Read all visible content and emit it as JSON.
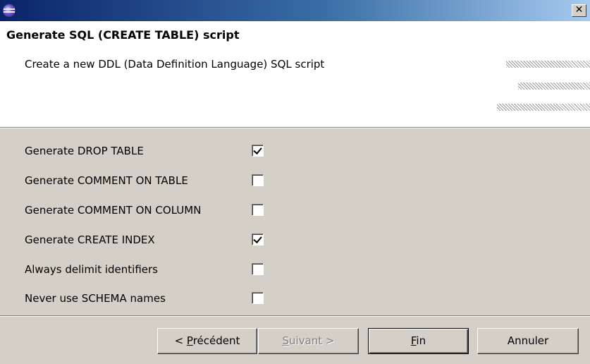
{
  "window": {
    "close_glyph": "✕"
  },
  "header": {
    "title": "Generate SQL (CREATE TABLE) script",
    "description": "Create a new DDL (Data Definition Language) SQL script"
  },
  "options": [
    {
      "label": "Generate DROP TABLE",
      "checked": true
    },
    {
      "label": "Generate COMMENT ON TABLE",
      "checked": false
    },
    {
      "label": "Generate COMMENT ON COLUMN",
      "checked": false
    },
    {
      "label": "Generate CREATE INDEX",
      "checked": true
    },
    {
      "label": "Always delimit identifiers",
      "checked": false
    },
    {
      "label": "Never use SCHEMA names",
      "checked": false
    }
  ],
  "buttons": {
    "back": {
      "prefix": "< ",
      "mnemonic": "P",
      "rest": "récédent"
    },
    "next": {
      "prefix": "",
      "mnemonic": "S",
      "rest": "uivant >",
      "enabled": false
    },
    "finish": {
      "prefix": "",
      "mnemonic": "F",
      "rest": "in"
    },
    "cancel": {
      "label": "Annuler"
    }
  }
}
